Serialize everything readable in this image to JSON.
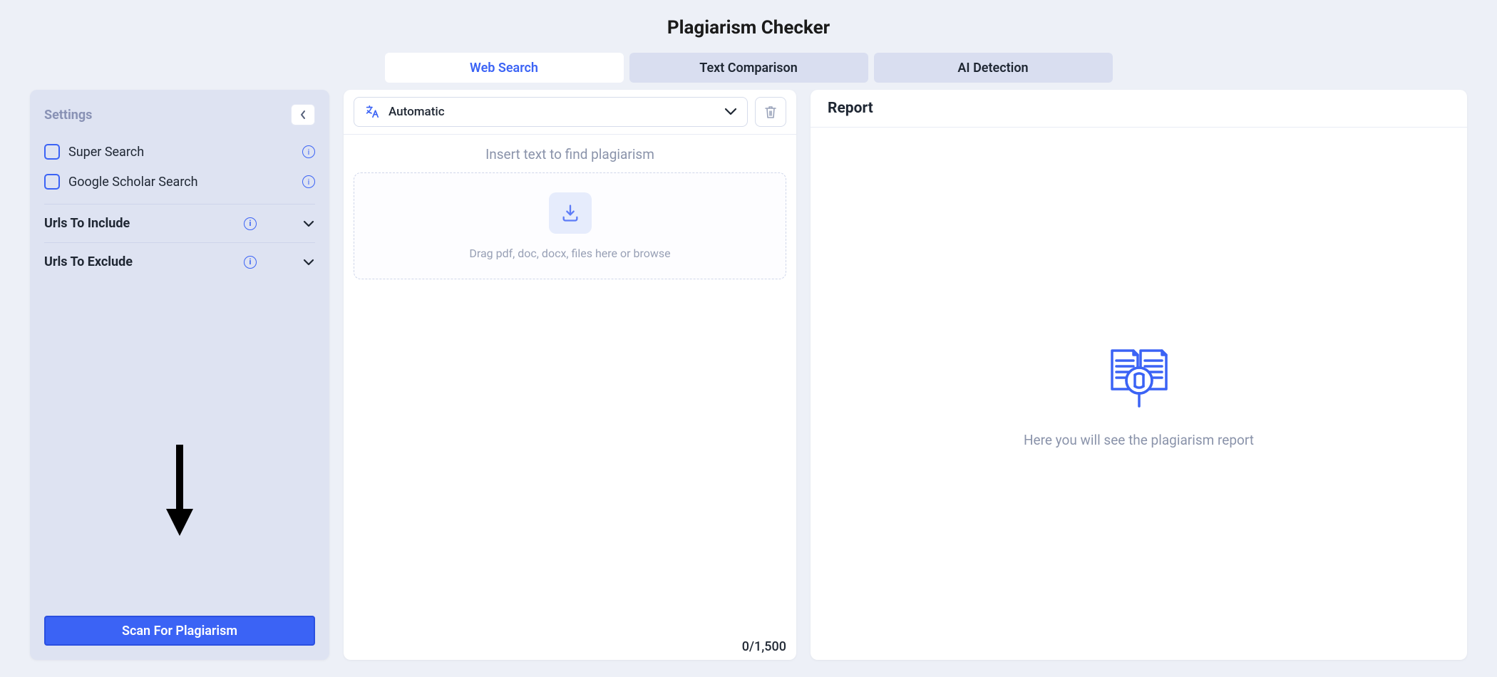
{
  "header": {
    "title": "Plagiarism Checker"
  },
  "tabs": {
    "items": [
      {
        "label": "Web Search"
      },
      {
        "label": "Text Comparison"
      },
      {
        "label": "AI Detection"
      }
    ]
  },
  "sidebar": {
    "title": "Settings",
    "checks": [
      {
        "label": "Super Search"
      },
      {
        "label": "Google Scholar Search"
      }
    ],
    "accordions": [
      {
        "label": "Urls To Include"
      },
      {
        "label": "Urls To Exclude"
      }
    ],
    "scan_label": "Scan For Plagiarism"
  },
  "editor": {
    "language_label": "Automatic",
    "instruction": "Insert text to find plagiarism",
    "drop_text": "Drag pdf, doc, docx, files here or browse",
    "counter": "0/1,500"
  },
  "report": {
    "title": "Report",
    "empty_text": "Here you will see the plagiarism report"
  }
}
